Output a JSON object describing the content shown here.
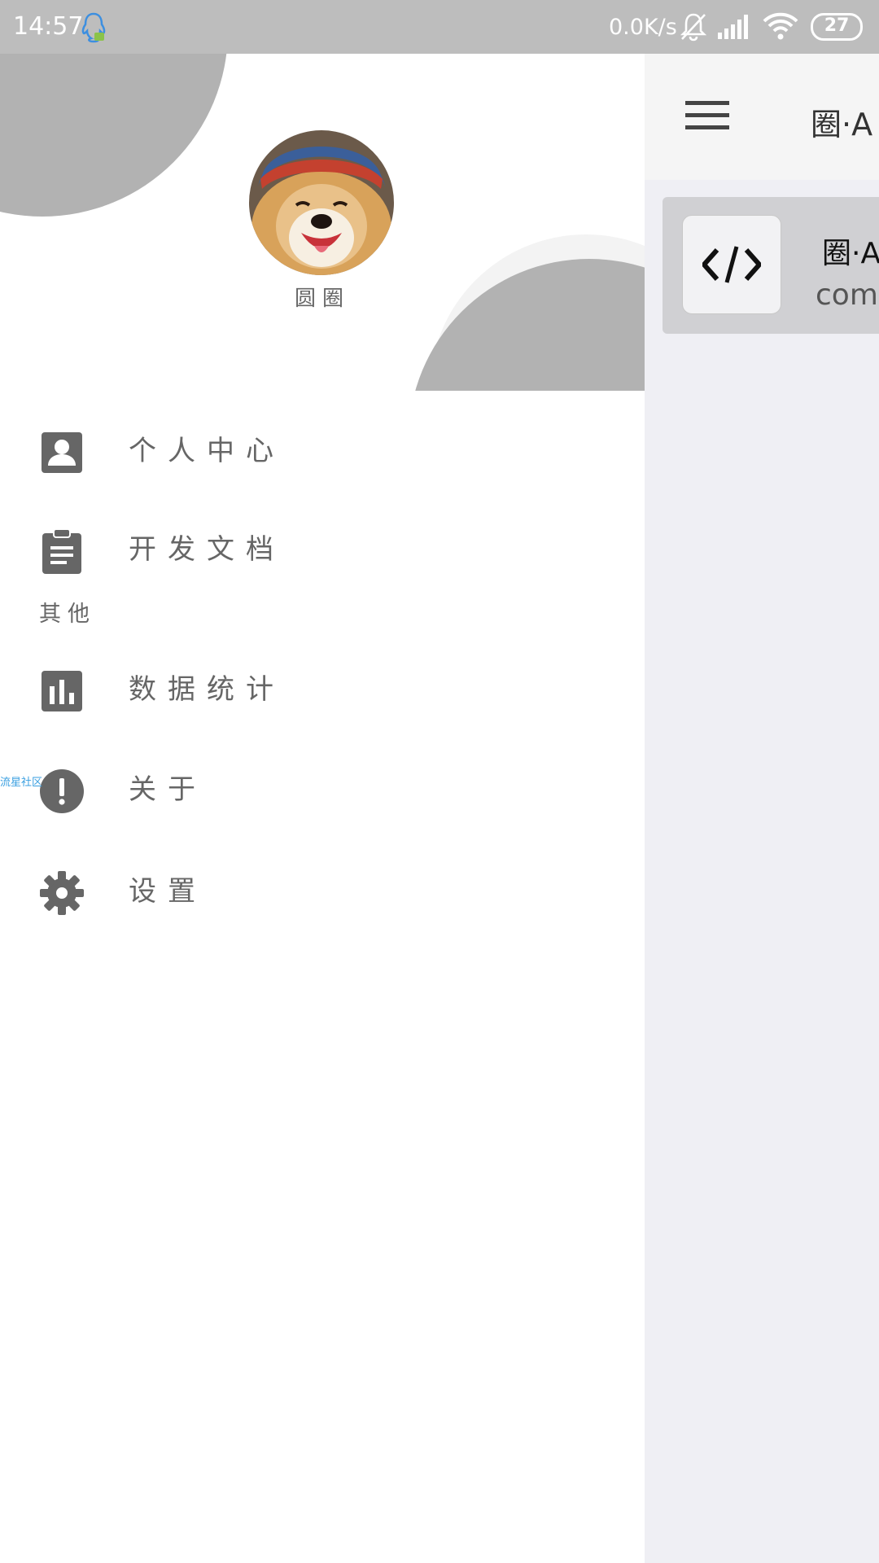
{
  "status_bar": {
    "time": "14:57",
    "net_speed": "0.0K/s",
    "battery": "27",
    "icons": [
      "qq-icon",
      "mute-icon",
      "signal-icon",
      "wifi-icon",
      "battery-icon"
    ]
  },
  "drawer": {
    "username": "圆圈",
    "items": [
      {
        "label": "个人中心",
        "icon": "account-box-icon"
      },
      {
        "label": "开发文档",
        "icon": "clipboard-icon"
      },
      {
        "label": "数据统计",
        "icon": "bar-chart-icon"
      },
      {
        "label": "关于",
        "icon": "info-icon"
      },
      {
        "label": "设置",
        "icon": "gear-icon"
      }
    ],
    "section_label": "其他",
    "watermark": "流星社区"
  },
  "main": {
    "title": "圈·A",
    "card": {
      "title": "圈·A",
      "subtitle": "com.",
      "icon": "code-icon"
    }
  },
  "colors": {
    "status_bar": "#bdbdbd",
    "drawer_bg": "#ffffff",
    "decor_gray": "#b2b2b2",
    "icon_gray": "#666666",
    "main_bg": "#efeff4"
  }
}
